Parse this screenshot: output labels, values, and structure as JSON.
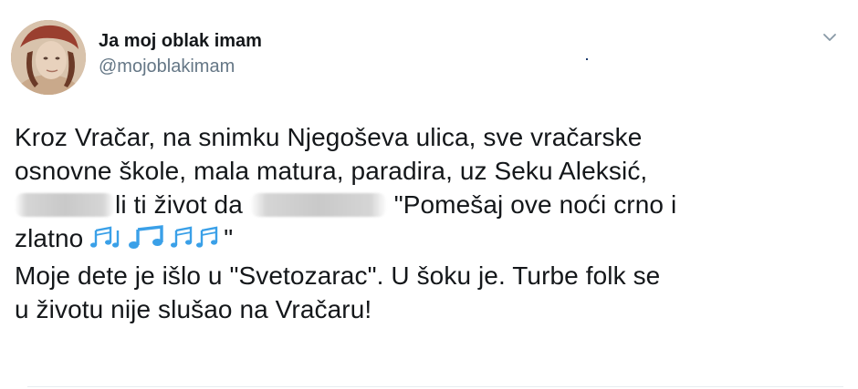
{
  "author": {
    "display_name": "Ja moj oblak imam",
    "handle": "@mojoblakimam"
  },
  "icons": {
    "caret": "chevron-down-icon",
    "avatar": "profile-photo",
    "emoji": "musical-notes-emoji"
  },
  "tweet": {
    "line1": "Kroz Vračar, na snimku Njegoševa ulica, sve vračarske",
    "line2": "osnovne škole, mala matura, paradira, uz Seku Aleksić,",
    "line3_a": "j",
    "line3_b": "li ti život da",
    "line3_c": "ti",
    "line3_d": "\"Pomešaj ove noći crno i",
    "line4_a": "zlatno",
    "line4_b": "\"",
    "line5": "Moje dete je išlo u \"Svetozarac\". U šoku je. Turbe folk se",
    "line6": "u životu nije slušao na Vračaru!"
  },
  "colors": {
    "text": "#14171a",
    "secondary": "#657786",
    "emoji_blue": "#3aa0e8",
    "divider": "#e6ecf0"
  }
}
